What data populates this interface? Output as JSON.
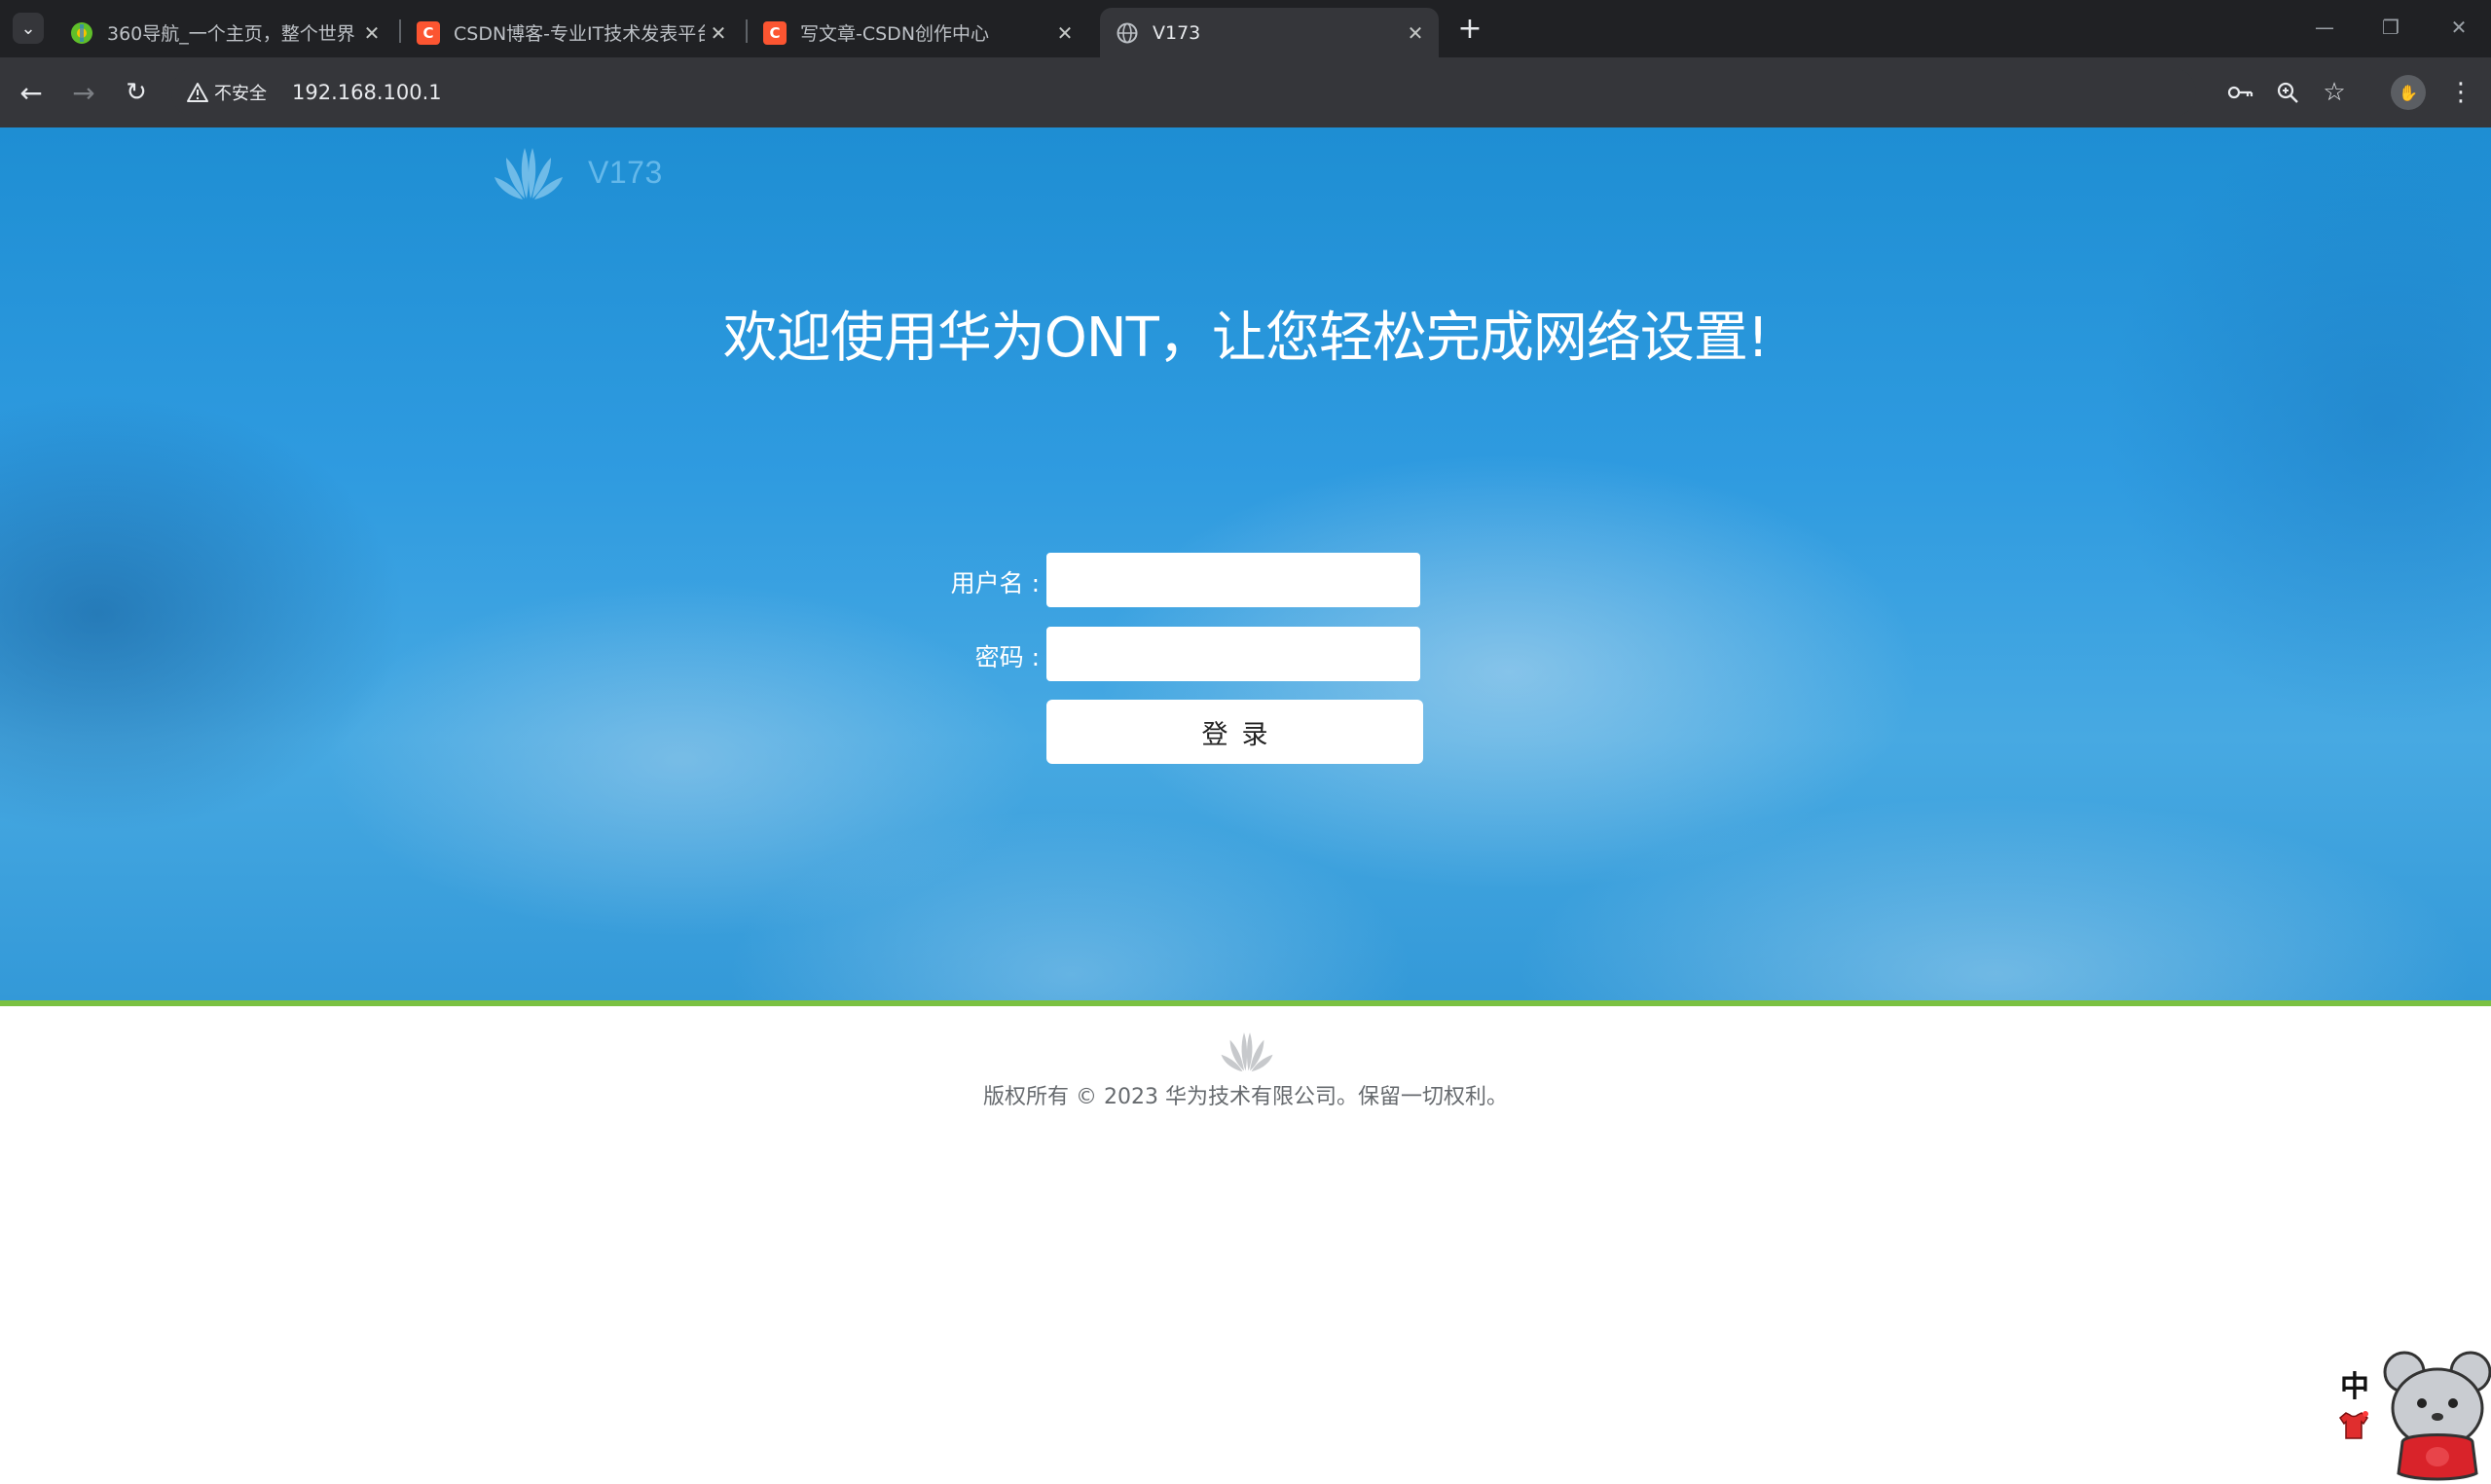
{
  "browser": {
    "tabs": [
      {
        "title": "360导航_一个主页，整个世界",
        "favicon": "360-nav-icon",
        "active": false
      },
      {
        "title": "CSDN博客-专业IT技术发表平台",
        "favicon": "csdn-icon",
        "active": false
      },
      {
        "title": "写文章-CSDN创作中心",
        "favicon": "csdn-icon",
        "active": false
      },
      {
        "title": "V173",
        "favicon": "globe-icon",
        "active": true
      }
    ],
    "security_label": "不安全",
    "url": "192.168.100.1"
  },
  "page": {
    "model": "V173",
    "welcome_title": "欢迎使用华为ONT，让您轻松完成网络设置!",
    "username_label": "用户名 :",
    "password_label": "密码 :",
    "username_value": "",
    "password_value": "",
    "login_label": "登录",
    "copyright": "版权所有 © 2023 华为技术有限公司。保留一切权利。"
  },
  "widget": {
    "ime_label": "中"
  },
  "colors": {
    "hero_blue": "#2f9be0",
    "accent_green": "#7ac142",
    "brand_model_blue": "#64b8ea"
  }
}
